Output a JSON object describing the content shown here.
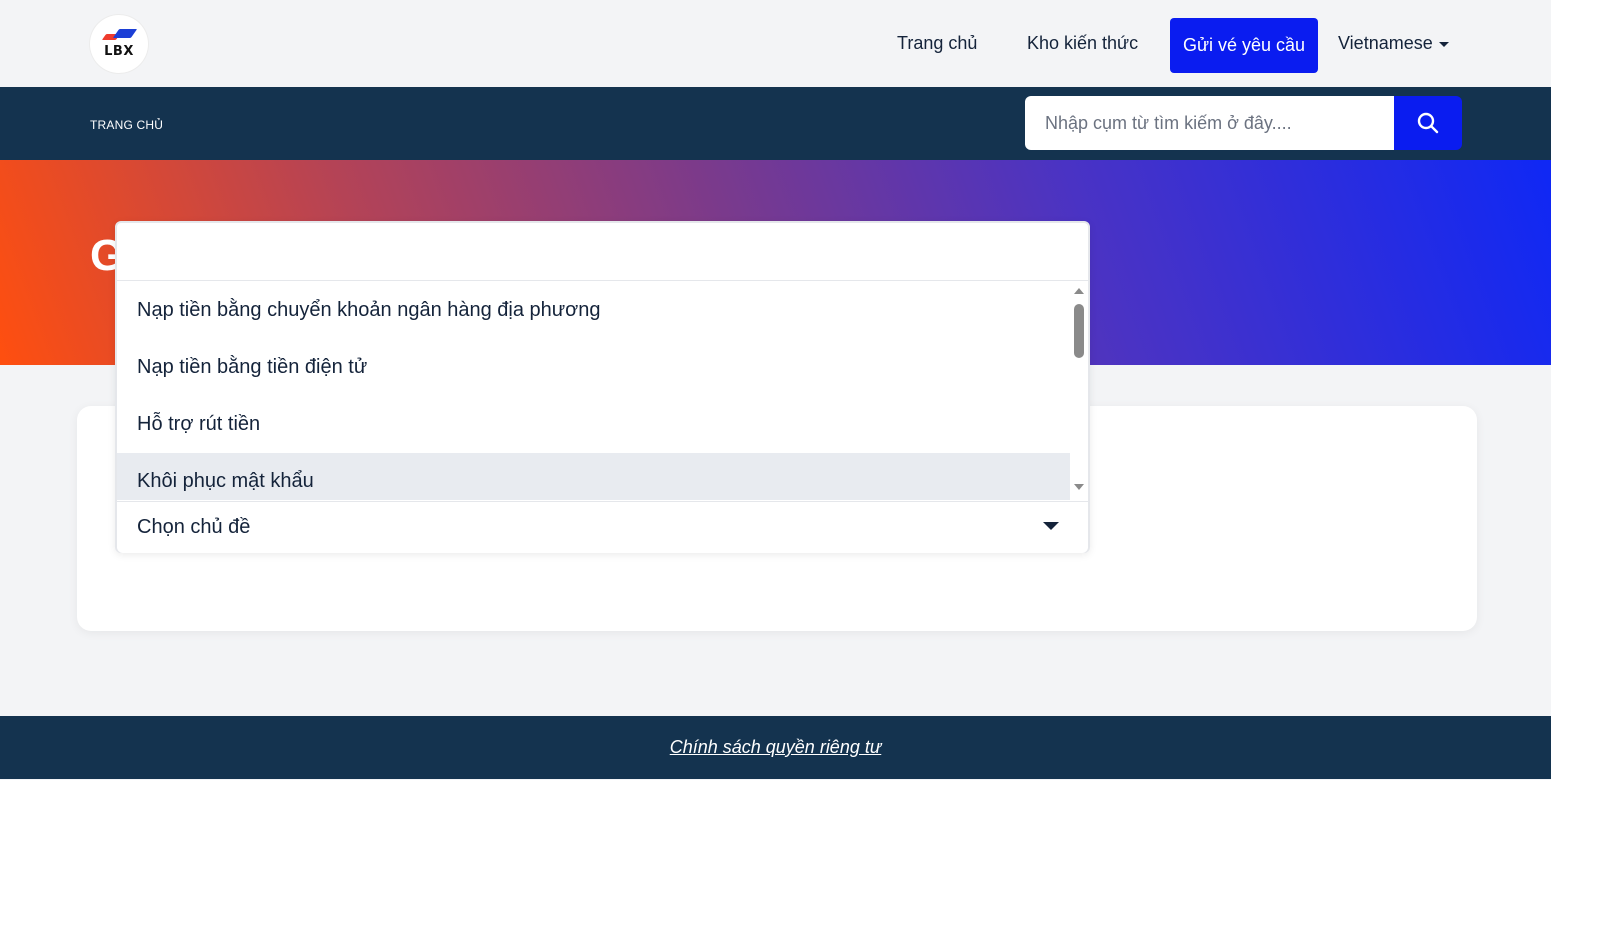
{
  "header": {
    "logo_text": "LBX",
    "nav": {
      "home": "Trang chủ",
      "knowledge_base": "Kho kiến thức",
      "submit_ticket": "Gửi vé yêu cầu",
      "language": "Vietnamese"
    }
  },
  "nav_band": {
    "breadcrumb": "TRANG CHỦ",
    "search": {
      "placeholder": "Nhập cụm từ tìm kiếm ở đây....",
      "icon": "search-icon"
    }
  },
  "hero": {
    "title_fragment": "G"
  },
  "dropdown": {
    "search_value": "",
    "options": [
      "Nạp tiền bằng chuyển khoản ngân hàng địa phương",
      "Nạp tiền bằng tiền điện tử",
      "Hỗ trợ rút tiền",
      "Khôi phục mật khẩu"
    ],
    "highlighted_index": 3,
    "selected_label": "Chọn chủ đề"
  },
  "footer": {
    "privacy_link": "Chính sách quyền riêng tư"
  },
  "colors": {
    "brand_blue": "#0a1cf0",
    "navy": "#14334f",
    "text_dark": "#14233a",
    "hero_start": "#ff4f0f",
    "hero_end": "#0f28f5"
  }
}
